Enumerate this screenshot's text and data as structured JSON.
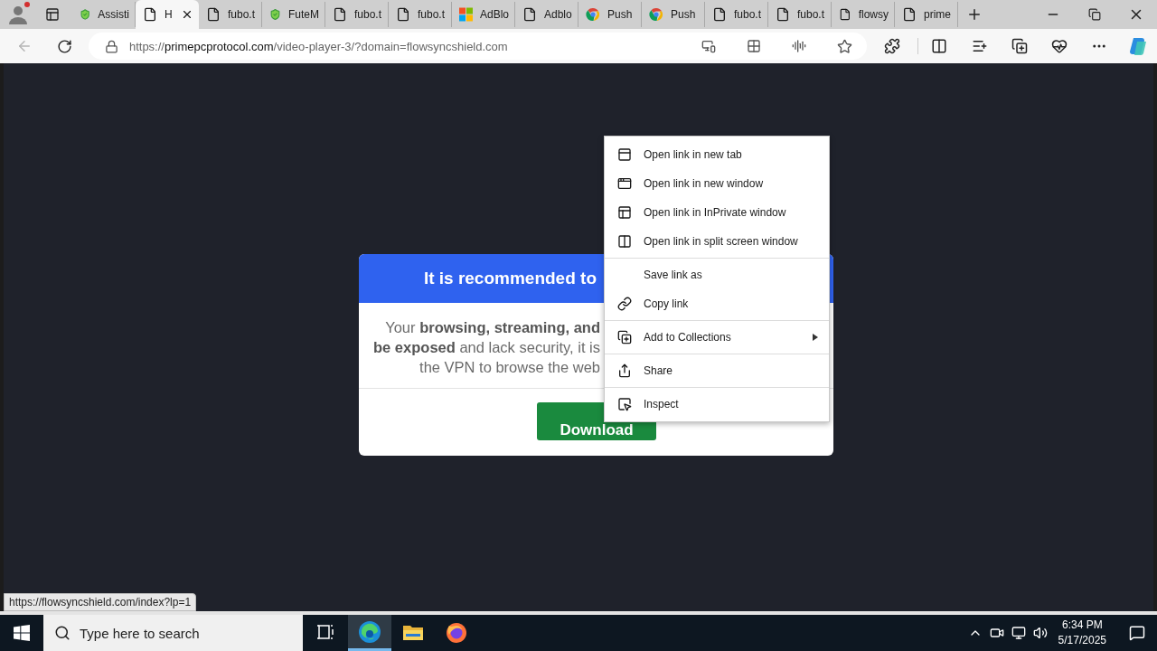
{
  "tabs": [
    {
      "title": "Assisti",
      "selected": false
    },
    {
      "title": "H",
      "selected": true
    },
    {
      "title": "fubo.t",
      "selected": false
    },
    {
      "title": "FuteM",
      "selected": false
    },
    {
      "title": "fubo.t",
      "selected": false
    },
    {
      "title": "fubo.t",
      "selected": false
    },
    {
      "title": "AdBlo",
      "selected": false
    },
    {
      "title": "Adblo",
      "selected": false
    },
    {
      "title": "Push",
      "selected": false
    },
    {
      "title": "Push",
      "selected": false
    },
    {
      "title": "fubo.t",
      "selected": false
    },
    {
      "title": "fubo.t",
      "selected": false
    },
    {
      "title": "flowsy",
      "selected": false
    },
    {
      "title": "prime",
      "selected": false
    }
  ],
  "back_button": {
    "disabled": true
  },
  "address_bar": {
    "scheme": "https://",
    "domain": "primepcprotocol.com",
    "path": "/video-player-3/?domain=flowsyncshield.com"
  },
  "dialog": {
    "title": "It is recommended to",
    "lines": [
      "Your **browsing, streaming, and**",
      "**be exposed** and lack security, it is",
      "the VPN to browse the web"
    ],
    "button": "Download"
  },
  "context_menu": {
    "groups": [
      [
        {
          "label": "Open link in new tab",
          "submenu": false
        },
        {
          "label": "Open link in new window",
          "submenu": false
        },
        {
          "label": "Open link in InPrivate window",
          "submenu": false
        },
        {
          "label": "Open link in split screen window",
          "submenu": false
        }
      ],
      [
        {
          "label": "Save link as",
          "submenu": false
        },
        {
          "label": "Copy link",
          "submenu": false
        }
      ],
      [
        {
          "label": "Add to Collections",
          "submenu": true
        }
      ],
      [
        {
          "label": "Share",
          "submenu": false
        }
      ],
      [
        {
          "label": "Inspect",
          "submenu": false
        }
      ]
    ]
  },
  "link_preview": "https://flowsyncshield.com/index?lp=1",
  "taskbar": {
    "search_placeholder": "Type here to search",
    "apps": [
      {
        "selected": false
      },
      {
        "selected": true
      },
      {
        "selected": false
      },
      {
        "selected": false
      }
    ],
    "time": "6:34 PM",
    "date": "5/17/2025"
  }
}
